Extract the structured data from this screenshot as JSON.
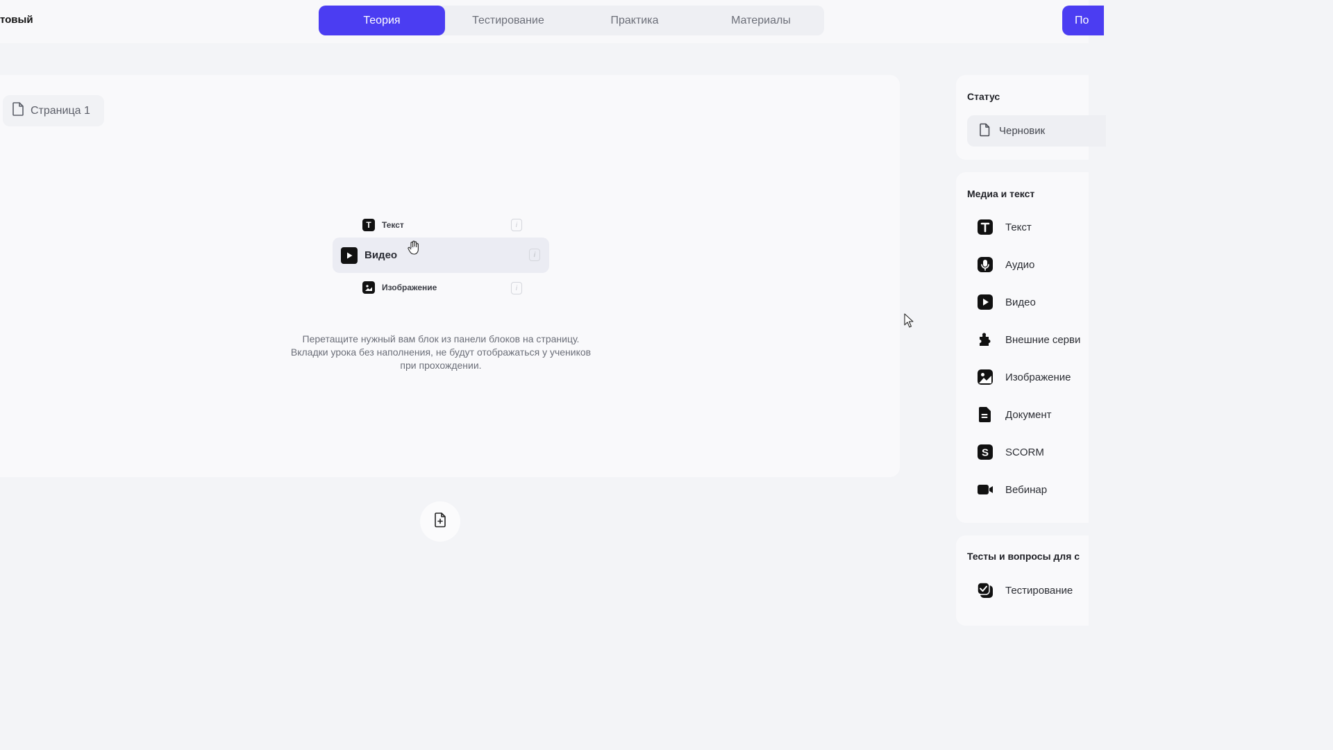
{
  "header": {
    "course_title": "товый",
    "tabs": [
      {
        "label": "Теория",
        "active": true
      },
      {
        "label": "Тестирование",
        "active": false
      },
      {
        "label": "Практика",
        "active": false
      },
      {
        "label": "Материалы",
        "active": false
      }
    ],
    "publish_label": "По"
  },
  "page_chip": {
    "label": "Страница 1"
  },
  "drag_preview": {
    "items": [
      {
        "label": "Текст",
        "icon": "text-icon"
      },
      {
        "label": "Видео",
        "icon": "video-icon"
      },
      {
        "label": "Изображение",
        "icon": "image-icon"
      }
    ]
  },
  "hint": {
    "line1": "Перетащите нужный вам блок из панели блоков на страницу.",
    "line2": "Вкладки урока без наполнения, не будут отображаться у учеников",
    "line3": "при прохождении."
  },
  "sidebar": {
    "status_title": "Статус",
    "status_value": "Черновик",
    "media_title": "Медиа и текст",
    "media_items": [
      {
        "label": "Текст",
        "icon": "text-icon"
      },
      {
        "label": "Аудио",
        "icon": "microphone-icon"
      },
      {
        "label": "Видео",
        "icon": "video-icon"
      },
      {
        "label": "Внешние серви",
        "icon": "puzzle-icon"
      },
      {
        "label": "Изображение",
        "icon": "image-icon"
      },
      {
        "label": "Документ",
        "icon": "document-icon"
      },
      {
        "label": "SCORM",
        "icon": "scorm-icon"
      },
      {
        "label": "Вебинар",
        "icon": "webinar-camera-icon"
      }
    ],
    "tests_title": "Тесты и вопросы для с",
    "tests_items": [
      {
        "label": "Тестирование",
        "icon": "checklist-icon"
      }
    ]
  },
  "colors": {
    "accent": "#4b3df2",
    "background": "#f3f4f7",
    "card": "#f9f9fb"
  }
}
